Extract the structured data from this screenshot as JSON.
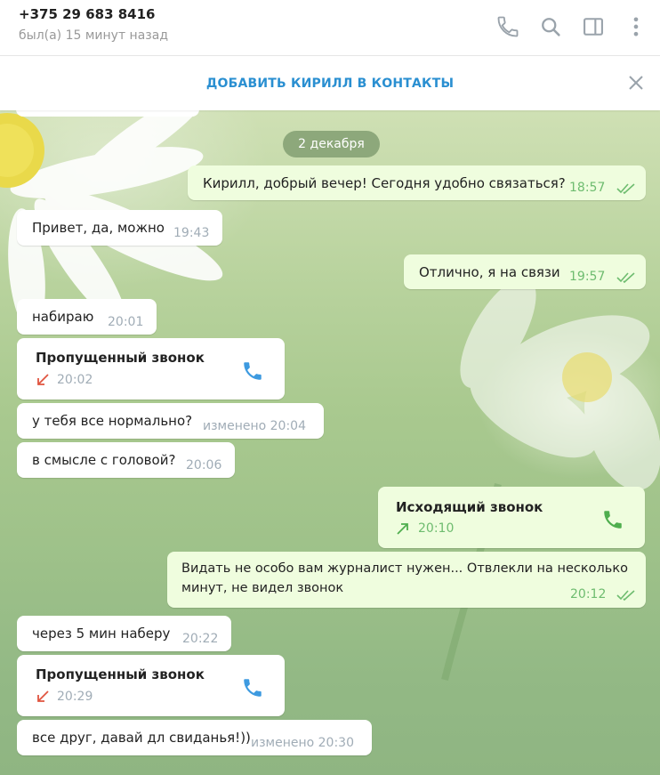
{
  "header": {
    "title": "+375 29 683 8416",
    "subtitle": "был(а) 15 минут назад",
    "icons": [
      "phone-icon",
      "search-icon",
      "sidebar-icon",
      "more-icon"
    ]
  },
  "addbar": {
    "label": "ДОБАВИТЬ КИРИЛЛ В КОНТАКТЫ"
  },
  "date_separator": "2 декабря",
  "colors": {
    "accent": "#2a8fd1",
    "out_bubble": "#effdde",
    "out_time": "#6ebc6f",
    "missed": "#e0543f",
    "outgoing": "#4fae4e"
  },
  "messages": [
    {
      "dir": "out",
      "text": "Кирилл, добрый вечер! Сегодня удобно связаться?",
      "time": "18:57"
    },
    {
      "dir": "in",
      "text": "Привет, да, можно",
      "time": "19:43"
    },
    {
      "dir": "out",
      "text": "Отлично, я на связи",
      "time": "19:57"
    },
    {
      "dir": "in",
      "text": "набираю",
      "time": "20:01"
    },
    {
      "dir": "in",
      "type": "call",
      "title": "Пропущенный звонок",
      "time": "20:02"
    },
    {
      "dir": "in",
      "text": "у тебя все нормально?",
      "time": "изменено 20:04"
    },
    {
      "dir": "in",
      "text": "в смысле с головой?",
      "time": "20:06"
    },
    {
      "dir": "out",
      "type": "call",
      "title": "Исходящий звонок",
      "time": "20:10"
    },
    {
      "dir": "out",
      "text_line1": "Видать не особо вам журналист нужен... Отвлекли на несколько",
      "text_line2": "минут, не видел звонок",
      "time": "20:12"
    },
    {
      "dir": "in",
      "text": "через 5 мин наберу",
      "time": "20:22"
    },
    {
      "dir": "in",
      "type": "call",
      "title": "Пропущенный звонок",
      "time": "20:29"
    },
    {
      "dir": "in",
      "text": "все друг, давай дл свиданья!))",
      "time": "изменено 20:30"
    }
  ]
}
